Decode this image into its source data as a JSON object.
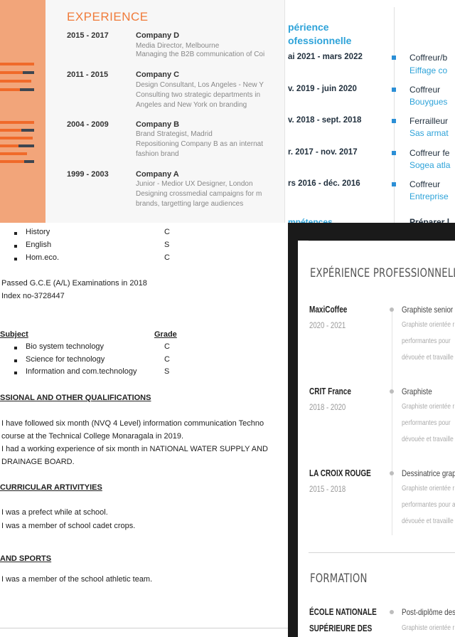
{
  "top_left": {
    "heading": "EXPERIENCE",
    "entries": [
      {
        "years": "2015 - 2017",
        "company": "Company D",
        "lines": [
          "Media Director, Melbourne",
          "Managing the B2B communication of Coi"
        ]
      },
      {
        "years": "2011 - 2015",
        "company": "Company C",
        "lines": [
          "Design Consultant, Los Angeles - New Y",
          "Consulting two strategic departments in",
          "Angeles and New York on branding"
        ]
      },
      {
        "years": "2004 - 2009",
        "company": "Company B",
        "lines": [
          "Brand Strategist, Madrid",
          "Repositioning Company B as an internat",
          "fashion brand"
        ]
      },
      {
        "years": "1999 - 2003",
        "company": "Company A",
        "lines": [
          "Junior - Medior  UX Designer, London",
          "Designing crossmedial campaigns for m",
          "brands, targetting large audiences"
        ]
      }
    ]
  },
  "top_right": {
    "heading_line1": "périence",
    "heading_line2": "ofessionnelle",
    "entries": [
      {
        "dates": "ai 2021 - mars 2022",
        "title": "Coffreur/b",
        "company": "Eiffage co"
      },
      {
        "dates": "v. 2019 - juin 2020",
        "title": "Coffreur",
        "company": "Bouygues"
      },
      {
        "dates": "v. 2018 - sept. 2018",
        "title": "Ferrailleur",
        "company": "Sas armat"
      },
      {
        "dates": "r. 2017 - nov. 2017",
        "title": "Coffreur fe",
        "company": "Sogea atla"
      },
      {
        "dates": "rs 2016 - déc. 2016",
        "title": "Coffreur",
        "company": "Entreprise"
      }
    ],
    "cut_bottom_left": "mpétences",
    "cut_bottom_right": "Préparer l"
  },
  "bottom_left": {
    "subjects_top": [
      {
        "name": "History",
        "grade": "C"
      },
      {
        "name": "English",
        "grade": "S"
      },
      {
        "name": "Hom.eco.",
        "grade": "C"
      }
    ],
    "al_passed": "Passed G.C.E (A/L) Examinations in 2018",
    "index_no": "Index no-3728447",
    "subject_header": "Subject",
    "grade_header": "Grade",
    "subjects_al": [
      {
        "name": "Bio system technology",
        "grade": "C"
      },
      {
        "name": "Science for technology",
        "grade": "C"
      },
      {
        "name": "Information and com.technology",
        "grade": "S"
      }
    ],
    "prof_heading": "SSIONAL AND OTHER QUALIFICATIONS",
    "prof_items": [
      {
        "line1": "I have followed six month (NVQ 4 Level) information communication Techno",
        "line2": "course at the Technical College Monaragala in 2019."
      },
      {
        "line1": "I had a working experience of six month in NATIONAL WATER SUPPLY AND",
        "line2": "DRAINAGE BOARD."
      }
    ],
    "extra_heading": "CURRICULAR ARTIVITYIES",
    "extra_items": [
      "I was a prefect while at school.",
      "I was a member of school cadet crops."
    ],
    "sports_heading": "AND SPORTS",
    "sports_items": [
      "I was a member of the school athletic team."
    ]
  },
  "bottom_right": {
    "section1": "EXPÉRIENCE PROFESSIONNELLE",
    "jobs": [
      {
        "company": "MaxiCoffee",
        "years": "2020 - 2021",
        "role": "Graphiste senior",
        "desc": [
          "Graphiste orientée r",
          "performantes pour",
          "dévouée et travaille"
        ]
      },
      {
        "company": "CRIT France",
        "years": "2018 - 2020",
        "role": "Graphiste",
        "desc": [
          "Graphiste orientée r",
          "performantes pour",
          "dévouée et travaille"
        ]
      },
      {
        "company": "LA CROIX ROUGE",
        "years": "2015 - 2018",
        "role": "Dessinatrice graph",
        "desc": [
          "Graphiste orientée r",
          "performantes pour a",
          "dévouée et travaille"
        ]
      }
    ],
    "section2": "FORMATION",
    "school_line1": "ÉCOLE NATIONALE",
    "school_line2": "SUPÉRIEURE DES",
    "degree": "Post-diplôme des",
    "degree_desc": "Graphiste orientée r"
  },
  "colors": {
    "orange_accent": "#f07b3a",
    "blue_heading": "#2ea3d9",
    "blue_square": "#2b8fd6",
    "dark_bg": "#1a1a1a"
  }
}
